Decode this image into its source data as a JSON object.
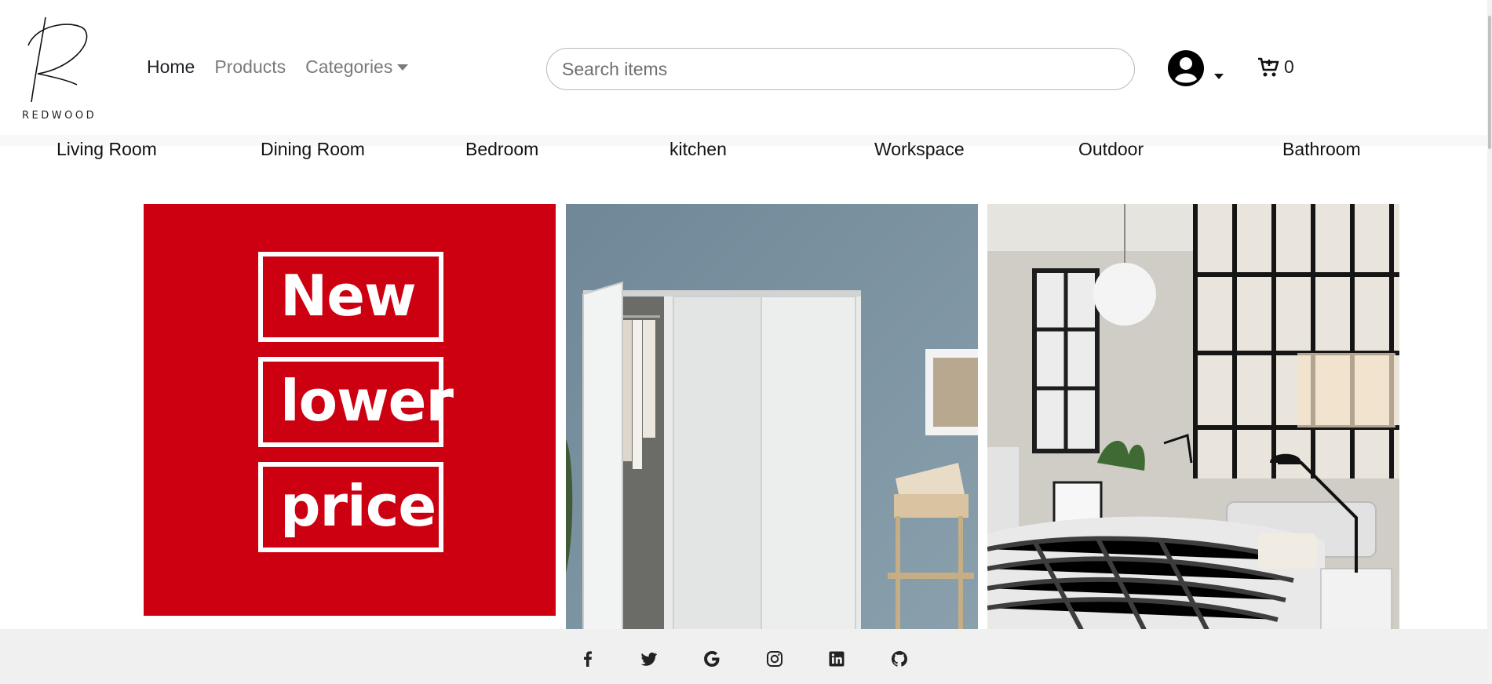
{
  "brand": {
    "name": "REDWOOD"
  },
  "nav": {
    "home": "Home",
    "products": "Products",
    "categories": "Categories"
  },
  "search": {
    "placeholder": "Search items",
    "value": ""
  },
  "cart": {
    "count": "0"
  },
  "categories": [
    "Living Room",
    "Dining Room",
    "Bedroom",
    "kitchen",
    "Workspace",
    "Outdoor",
    "Bathroom"
  ],
  "promo": {
    "lines": [
      "New",
      "lower",
      "price"
    ]
  },
  "social": [
    "facebook-icon",
    "twitter-icon",
    "google-icon",
    "instagram-icon",
    "linkedin-icon",
    "github-icon"
  ],
  "colors": {
    "promo_red": "#cc0011",
    "footer_bg": "#f0f0f0",
    "wall_blue": "#7b92a1"
  }
}
